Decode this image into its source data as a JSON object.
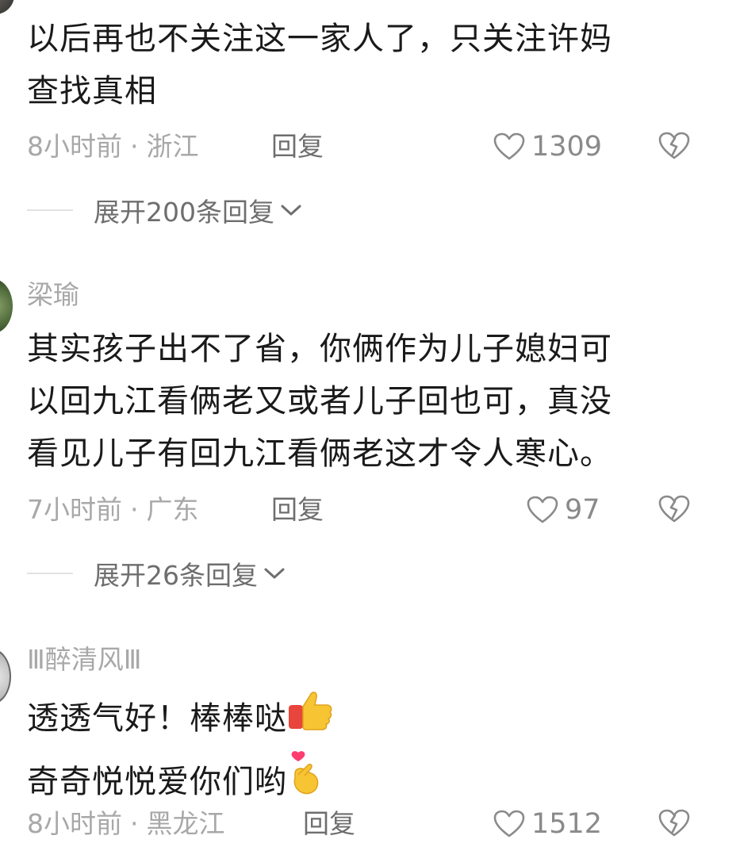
{
  "comments": [
    {
      "username": "",
      "lines": [
        "以后再也不关注这一家人了，只关注许妈",
        "查找真相"
      ],
      "time": "8小时前",
      "location": "浙江",
      "reply_label": "回复",
      "likes": "1309",
      "expand_label": "展开200条回复"
    },
    {
      "username": "梁瑜",
      "lines": [
        "其实孩子出不了省，你俩作为儿子媳妇可",
        "以回九江看俩老又或者儿子回也可，真没",
        "看见儿子有回九江看俩老这才令人寒心。"
      ],
      "time": "7小时前",
      "location": "广东",
      "reply_label": "回复",
      "likes": "97",
      "expand_label": "展开26条回复"
    },
    {
      "username": "Ⅲ醉清风Ⅲ",
      "lines": [
        "透透气好！棒棒哒",
        "奇奇悦悦爱你们哟"
      ],
      "time": "8小时前",
      "location": "黑龙江",
      "reply_label": "回复",
      "likes": "1512"
    }
  ],
  "meta_separator": "·",
  "icons": {
    "like": "heart-outline-icon",
    "dislike": "broken-heart-icon",
    "expand": "chevron-down-icon",
    "emoji_1": "thumbs-up-emoji",
    "emoji_2": "finger-heart-emoji"
  },
  "colors": {
    "text": "#1a1a1a",
    "secondary": "#a8a8a8",
    "action": "#6e6e6e"
  }
}
